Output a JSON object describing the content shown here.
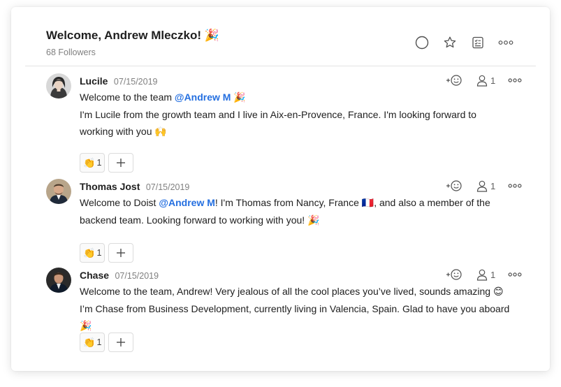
{
  "thread": {
    "title": "Welcome, Andrew Mleczko! 🎉",
    "followers": "68 Followers"
  },
  "header_actions": [
    "circle-icon",
    "star-icon",
    "checklist-icon",
    "more-icon"
  ],
  "comments": [
    {
      "author": "Lucile",
      "date": "07/15/2019",
      "seen_count": "1",
      "line1_pre": "Welcome to the team ",
      "line1_mention": "@Andrew M",
      "line1_post": " 🎉",
      "para2": "I'm Lucile from the growth team and I live in Aix-en-Provence, France. I'm looking forward to working with you 🙌",
      "reaction_emoji": "👏",
      "reaction_count": "1"
    },
    {
      "author": "Thomas Jost",
      "date": "07/15/2019",
      "seen_count": "1",
      "line1_pre": "Welcome to Doist ",
      "line1_mention": "@Andrew M",
      "line1_post": "! I'm Thomas from Nancy, France 🇫🇷, and also a member of the backend team. Looking forward to working with you! 🎉",
      "reaction_emoji": "👏",
      "reaction_count": "1"
    },
    {
      "author": "Chase",
      "date": "07/15/2019",
      "seen_count": "1",
      "text": "Welcome to the team, Andrew! Very jealous of all the cool places you’ve lived, sounds amazing 😊 I’m Chase from Business Development, currently living in Valencia, Spain. Glad to have you aboard 🎉",
      "reaction_emoji": "👏",
      "reaction_count": "1"
    }
  ],
  "colors": {
    "mention": "#246fe0",
    "text": "#202020",
    "muted": "#808080"
  }
}
